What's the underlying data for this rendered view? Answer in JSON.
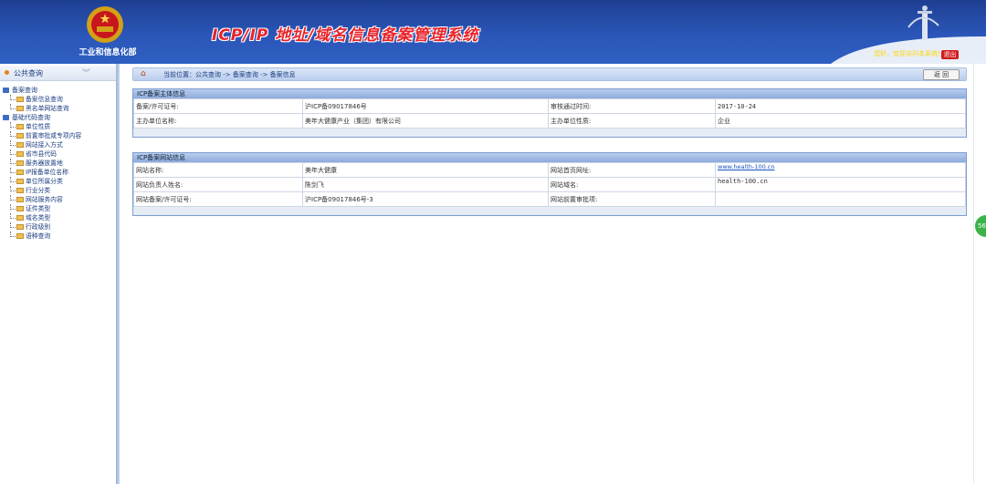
{
  "header": {
    "ministry": "工业和信息化部",
    "title": "ICP/IP 地址/域名信息备案管理系统",
    "welcome": "您好，欢迎访问本系统!",
    "logout_label": "退出"
  },
  "sidebar": {
    "section_title": "公共查询",
    "groups": [
      {
        "label": "备案查询",
        "items": [
          "备案信息查询",
          "黑名单网站查询"
        ]
      },
      {
        "label": "基础代码查询",
        "items": [
          "单位性质",
          "前置审批或专项内容",
          "网站接入方式",
          "省市县代码",
          "服务器放置地",
          "IP报备单位名称",
          "单位所属分类",
          "行业分类",
          "网站服务内容",
          "证件类型",
          "域名类型",
          "行政级别",
          "语种查询"
        ]
      }
    ]
  },
  "breadcrumb": {
    "text": "当前位置：公共查询 -> 备案查询 -> 备案信息"
  },
  "back_label": "返 回",
  "subject_panel": {
    "title": "ICP备案主体信息",
    "rows": [
      [
        "备案/许可证号:",
        "沪ICP备09017846号",
        "审核通过时间:",
        "2017-10-24"
      ],
      [
        "主办单位名称:",
        "美年大健康产业（集团）有限公司",
        "主办单位性质:",
        "企业"
      ]
    ]
  },
  "site_panel": {
    "title": "ICP备案网站信息",
    "rows": [
      [
        "网站名称:",
        "美年大健康",
        "网站首页网址:",
        "www.health-100.cn"
      ],
      [
        "网站负责人姓名:",
        "陈剑飞",
        "网站域名:",
        "health-100.cn"
      ],
      [
        "网站备案/许可证号:",
        "沪ICP备09017846号-3",
        "网站前置审批项:",
        ""
      ]
    ]
  },
  "badge": "56",
  "colors": {
    "header": "#2a56b8",
    "title": "#e8242b",
    "link": "#1a52c4"
  }
}
